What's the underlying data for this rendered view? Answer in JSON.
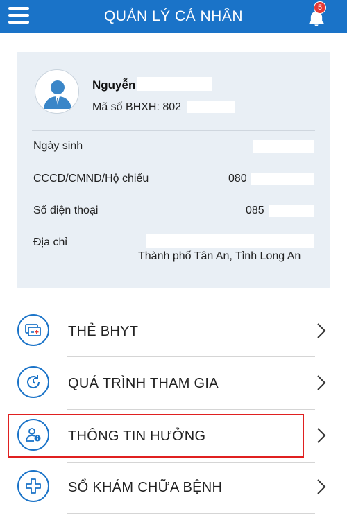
{
  "header": {
    "title": "QUẢN LÝ CÁ NHÂN",
    "notification_count": "5"
  },
  "profile": {
    "name": "Nguyễn",
    "bhxh_id": "Mã số BHXH: 802",
    "rows": [
      {
        "label": "Ngày sinh",
        "value": ""
      },
      {
        "label": "CCCD/CMND/Hộ chiếu",
        "value": "080"
      },
      {
        "label": "Số điện thoại",
        "value": "085"
      },
      {
        "label": "Địa chỉ",
        "value": "Thành phố Tân An, Tỉnh Long An"
      }
    ]
  },
  "menu": [
    {
      "label": "THẺ BHYT",
      "icon": "health-card-icon"
    },
    {
      "label": "QUÁ TRÌNH THAM GIA",
      "icon": "history-icon"
    },
    {
      "label": "THÔNG TIN HƯỞNG",
      "icon": "user-info-icon"
    },
    {
      "label": "SỔ KHÁM CHỮA BỆNH",
      "icon": "medical-cross-icon"
    }
  ],
  "colors": {
    "primary": "#1a73c8",
    "card_bg": "#e9eff5",
    "highlight": "#e02020",
    "badge": "#e53935"
  }
}
